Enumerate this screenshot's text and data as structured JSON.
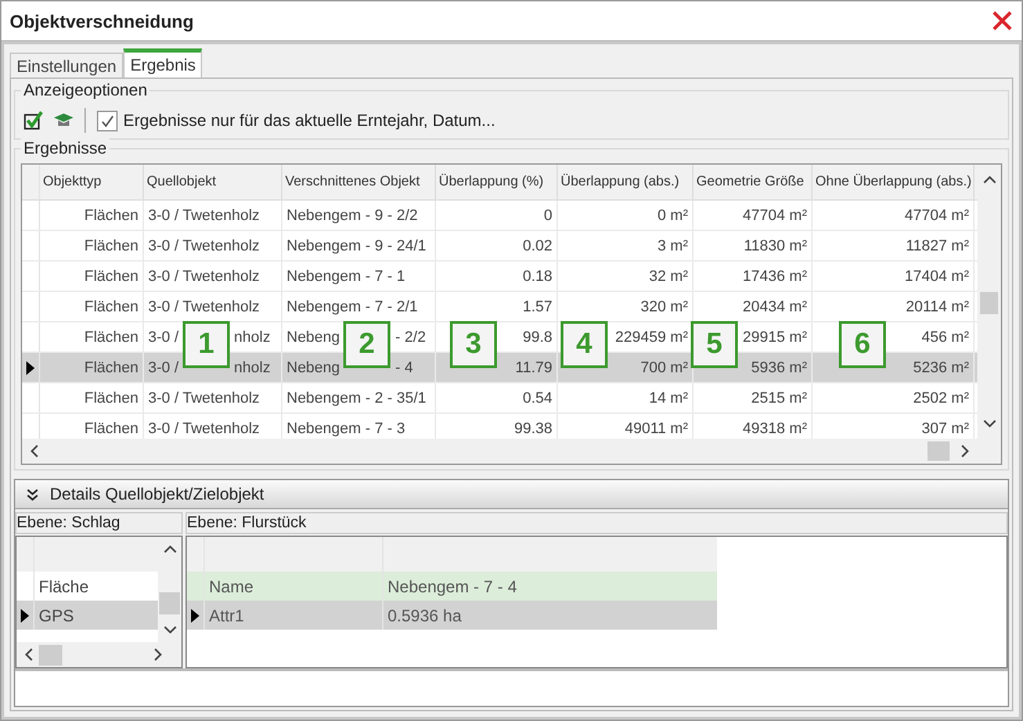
{
  "window": {
    "title": "Objektverschneidung"
  },
  "tabs": [
    {
      "label": "Einstellungen",
      "selected": false
    },
    {
      "label": "Ergebnis",
      "selected": true
    }
  ],
  "options": {
    "title": "Anzeigeoptionen",
    "checkbox": {
      "label": "Ergebnisse nur für das aktuelle Erntejahr, Datum...",
      "checked": true
    }
  },
  "results": {
    "title": "Ergebnisse",
    "columns": [
      "Objekttyp",
      "Quellobjekt",
      "Verschnittenes Objekt",
      "Überlappung (%)",
      "Überlappung (abs.)",
      "Geometrie Größe",
      "Ohne Überlappung (abs.)"
    ],
    "rows": [
      {
        "cells": [
          "Flächen",
          "3-0 / Twetenholz",
          "Nebengem - 9 - 2/2",
          "0",
          "0 m²",
          "47704 m²",
          "47704 m²"
        ],
        "selected": false
      },
      {
        "cells": [
          "Flächen",
          "3-0 / Twetenholz",
          "Nebengem - 9 - 24/1",
          "0.02",
          "3 m²",
          "11830 m²",
          "11827 m²"
        ],
        "selected": false
      },
      {
        "cells": [
          "Flächen",
          "3-0 / Twetenholz",
          "Nebengem - 7 - 1",
          "0.18",
          "32 m²",
          "17436 m²",
          "17404 m²"
        ],
        "selected": false
      },
      {
        "cells": [
          "Flächen",
          "3-0 / Twetenholz",
          "Nebengem - 7 - 2/1",
          "1.57",
          "320 m²",
          "20434 m²",
          "20114 m²"
        ],
        "selected": false
      },
      {
        "cells": [
          "Flächen",
          [
            "3-0 /",
            "nholz"
          ],
          [
            "Nebeng",
            "- 2/2"
          ],
          "99.8",
          "229459 m²",
          "29915 m²",
          "456 m²"
        ],
        "selected": false
      },
      {
        "cells": [
          "Flächen",
          [
            "3-0 /",
            "nholz"
          ],
          [
            "Nebeng",
            "- 4"
          ],
          "11.79",
          "700 m²",
          "5936 m²",
          "5236 m²"
        ],
        "selected": true
      },
      {
        "cells": [
          "Flächen",
          "3-0 / Twetenholz",
          "Nebengem - 2 - 35/1",
          "0.54",
          "14 m²",
          "2515 m²",
          "2502 m²"
        ],
        "selected": false
      },
      {
        "cells": [
          "Flächen",
          "3-0 / Twetenholz",
          "Nebengem - 7 - 3",
          "99.38",
          "49011 m²",
          "49318 m²",
          "307 m²"
        ],
        "selected": false
      }
    ],
    "callouts": [
      "1",
      "2",
      "3",
      "4",
      "5",
      "6"
    ]
  },
  "details": {
    "title": "Details Quellobjekt/Zielobjekt",
    "left": {
      "title": "Ebene: Schlag",
      "rows": [
        {
          "label": "Fläche",
          "selected": false
        },
        {
          "label": "GPS",
          "selected": true
        }
      ]
    },
    "right": {
      "title": "Ebene: Flurstück",
      "rows": [
        {
          "name": "Name",
          "value": "Nebengem - 7 - 4",
          "selected": false,
          "highlighted": true
        },
        {
          "name": "Attr1",
          "value": "0.5936 ha",
          "selected": true,
          "highlighted": false
        }
      ]
    }
  }
}
